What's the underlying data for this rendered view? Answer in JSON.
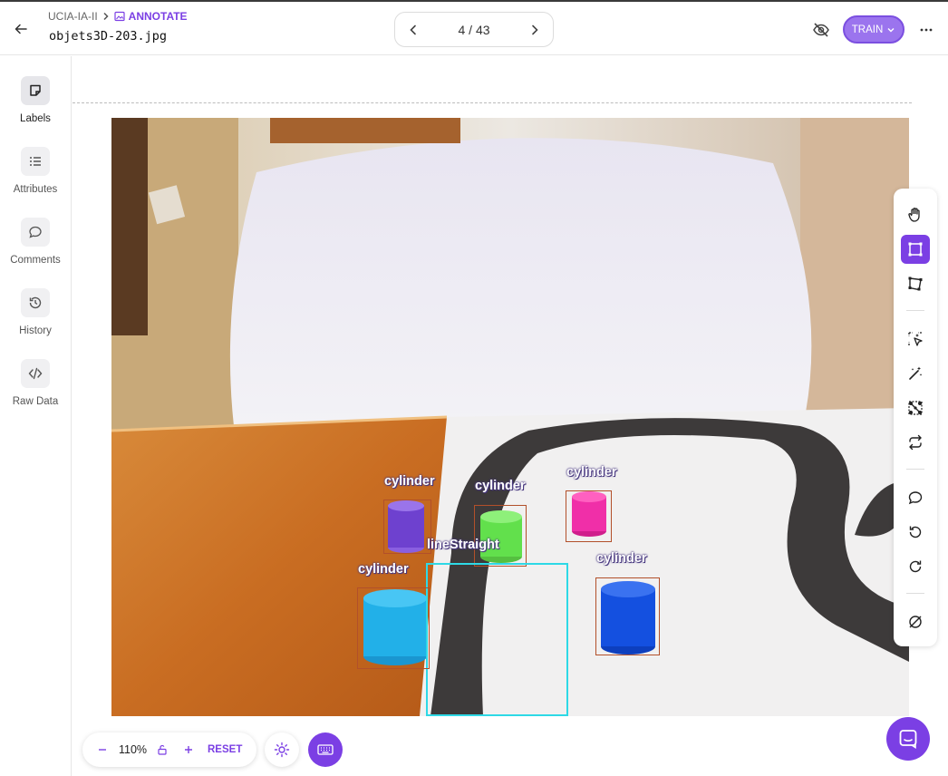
{
  "header": {
    "breadcrumb_project": "UCIA-IA-II",
    "breadcrumb_mode": "ANNOTATE",
    "filename": "objets3D-203.jpg",
    "pager_text": "4 / 43",
    "train_label": "TRAIN"
  },
  "sidebar": {
    "items": [
      {
        "label": "Labels",
        "icon": "sticky-note-icon"
      },
      {
        "label": "Attributes",
        "icon": "list-icon"
      },
      {
        "label": "Comments",
        "icon": "comment-icon"
      },
      {
        "label": "History",
        "icon": "history-icon"
      },
      {
        "label": "Raw Data",
        "icon": "code-icon"
      }
    ]
  },
  "annotations": [
    {
      "label": "cylinder",
      "color": "#7a49d8"
    },
    {
      "label": "cylinder",
      "color": "#62e04c"
    },
    {
      "label": "cylinder",
      "color": "#f02fa8"
    },
    {
      "label": "lineStraight",
      "color": "#2ed9e6"
    },
    {
      "label": "cylinder",
      "color": "#22b0e8"
    },
    {
      "label": "cylinder",
      "color": "#1450e0"
    }
  ],
  "zoom": {
    "level": "110%",
    "reset_label": "RESET"
  },
  "colors": {
    "accent": "#7b3fe4",
    "train_bg": "#9b74ee",
    "box_border": "#b2502a",
    "line_box_border": "#2ed9e6"
  }
}
